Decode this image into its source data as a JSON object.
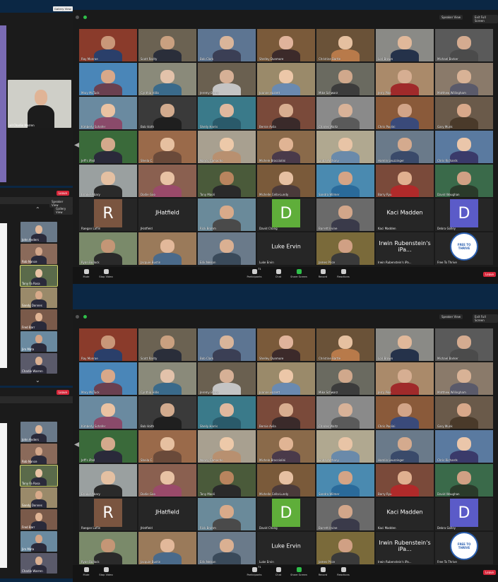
{
  "top_button": "Gallery View",
  "left": {
    "self_name": "all Charlie Warren",
    "leave_label": "Leave",
    "view_button": "Speaker View",
    "view_button2": "Gallery View",
    "list_a": [
      "John Anders",
      "Rob Nance",
      "Tony Fa Rosa",
      "Sandy Donnes",
      "Fred Barr",
      "Jim Mata",
      "Charlie Warren"
    ]
  },
  "window1": {
    "speaker_view": "Speaker View",
    "exit_full": "Exit Full Screen",
    "leave": "Leave",
    "participants_count": "71"
  },
  "window2": {
    "speaker_view": "Speaker View",
    "exit_full": "Exit Full Screen",
    "leave": "Leave",
    "participants_count": "71"
  },
  "controls": {
    "mute": "Mute",
    "stop_video": "Stop Video",
    "participants": "Participants",
    "chat": "Chat",
    "share_screen": "Share Screen",
    "record": "Record",
    "reactions": "Reactions"
  },
  "participants": [
    {
      "name": "Ray Monroe",
      "type": "video",
      "bg": "#8a3b2b",
      "skin": "#c99779",
      "shirt": "#2a3f6a"
    },
    {
      "name": "Scott Rarity",
      "type": "video",
      "bg": "#6b6252",
      "skin": "#c9a080",
      "shirt": "#2a2e3a"
    },
    {
      "name": "Bob Clark",
      "type": "video",
      "bg": "#5d7592",
      "skin": "#d9b59a",
      "shirt": "#3b3f55"
    },
    {
      "name": "Shelley Dunmore",
      "type": "video",
      "bg": "#7a5a3a",
      "skin": "#e0b39b",
      "shirt": "#3c2a2a"
    },
    {
      "name": "Christine Bartle",
      "type": "video",
      "bg": "#6a5238",
      "skin": "#e5c0a0",
      "shirt": "#b87a4a"
    },
    {
      "name": "Lori Brown",
      "type": "video",
      "bg": "#8a8a86",
      "skin": "#e0b89a",
      "shirt": "#25324a"
    },
    {
      "name": "Michael Barker",
      "type": "video",
      "bg": "#5a5a5a",
      "skin": "#d4ab90",
      "shirt": "#4b4b4b"
    },
    {
      "name": "Mary McTuck",
      "type": "video",
      "bg": "#4a86b8",
      "skin": "#d8a889",
      "shirt": "#6a4050"
    },
    {
      "name": "Cynthia Hillis",
      "type": "video",
      "bg": "#8a8a7a",
      "skin": "#e2c2aa",
      "shirt": "#3a6a8a"
    },
    {
      "name": "Jeremy Burns",
      "type": "video",
      "bg": "#6a6050",
      "skin": "#d6b096",
      "shirt": "#c4c4c4"
    },
    {
      "name": "Joanne Hazlett",
      "type": "video",
      "bg": "#9a8a6a",
      "skin": "#ecc7a8",
      "shirt": "#6a8ab0"
    },
    {
      "name": "Mike Schwarz",
      "type": "video",
      "bg": "#6a6a60",
      "skin": "#d0a88c",
      "shirt": "#3c3c3c"
    },
    {
      "name": "Jerry Pike",
      "type": "video",
      "bg": "#aa8a6a",
      "skin": "#d6ae92",
      "shirt": "#a02a2a"
    },
    {
      "name": "Matthew Willingham",
      "type": "video",
      "bg": "#8a7a6a",
      "skin": "#d8b296",
      "shirt": "#5a5a6a"
    },
    {
      "name": "Kimberly Schafer",
      "type": "video",
      "bg": "#6a8aa0",
      "skin": "#eac2a2",
      "shirt": "#8a4a6a"
    },
    {
      "name": "Bob Voith",
      "type": "video",
      "bg": "#3a3a3a",
      "skin": "#d2ab8e",
      "shirt": "#1f1f1f"
    },
    {
      "name": "Shelly Harris",
      "type": "video",
      "bg": "#3a7a8a",
      "skin": "#e0b89e",
      "shirt": "#2a5a6a"
    },
    {
      "name": "Bernie Avila",
      "type": "video",
      "bg": "#7a4a3a",
      "skin": "#d8ae90",
      "shirt": "#3a2a2a"
    },
    {
      "name": "Charles Waltz",
      "type": "video",
      "bg": "#8a8a8a",
      "skin": "#d8b298",
      "shirt": "#5a5a5a"
    },
    {
      "name": "Chris Paolini",
      "type": "video",
      "bg": "#8a5a3a",
      "skin": "#d2a488",
      "shirt": "#3a4a7a"
    },
    {
      "name": "Gary Munk",
      "type": "video",
      "bg": "#6a5a4a",
      "skin": "#d8a88a",
      "shirt": "#4a3a2a"
    },
    {
      "name": "Jeff's iPad",
      "type": "video",
      "bg": "#3a6a3a",
      "skin": "#d4a98c",
      "shirt": "#2a2a3a"
    },
    {
      "name": "Sheila C.",
      "type": "video",
      "bg": "#9a6a4a",
      "skin": "#e6c0a0",
      "shirt": "#6a4a3a"
    },
    {
      "name": "Nancy Camacho",
      "type": "video",
      "bg": "#a8a090",
      "skin": "#edc9a9",
      "shirt": "#b89070"
    },
    {
      "name": "Michele Bracciolini",
      "type": "video",
      "bg": "#8a6a4a",
      "skin": "#e0b494",
      "shirt": "#4a3a4a"
    },
    {
      "name": "Linda Anthony",
      "type": "video",
      "bg": "#b0a890",
      "skin": "#e8c4a6",
      "shirt": "#6a8aaa"
    },
    {
      "name": "Hamlin Leuzzinger",
      "type": "video",
      "bg": "#6a7a8a",
      "skin": "#d4aa8e",
      "shirt": "#3a4a6a"
    },
    {
      "name": "Chris Richards",
      "type": "video",
      "bg": "#5a7aa0",
      "skin": "#eac6aa",
      "shirt": "#3a3a6a"
    },
    {
      "name": "Brooke Abary",
      "type": "video",
      "bg": "#9aa0a0",
      "skin": "#e4c0a2",
      "shirt": "#2a2a2a"
    },
    {
      "name": "Dodie Goo",
      "type": "video",
      "bg": "#8a6050",
      "skin": "#e8c2a4",
      "shirt": "#9a4a6a"
    },
    {
      "name": "Tony Maoli",
      "type": "video",
      "bg": "#4a5a3a",
      "skin": "#b8845e",
      "shirt": "#2a2a2a"
    },
    {
      "name": "Michelle Cella-Lundy",
      "type": "video",
      "bg": "#7a5a3a",
      "skin": "#e6c0a2",
      "shirt": "#4a3a3a"
    },
    {
      "name": "Sandra Wilmer",
      "type": "video",
      "bg": "#4a8ab0",
      "skin": "#d4a486",
      "shirt": "#2a6a9a"
    },
    {
      "name": "Barry Ryu",
      "type": "video",
      "bg": "#7a4a3a",
      "skin": "#e0b090",
      "shirt": "#b02a2a"
    },
    {
      "name": "David Woughan",
      "type": "video",
      "bg": "#3a6a4a",
      "skin": "#d0a084",
      "shirt": "#2a3a2a"
    },
    {
      "name": "Raegan Laflin",
      "type": "letter",
      "letter": "R",
      "box": "#7a5540"
    },
    {
      "name": "JHatfield",
      "type": "text",
      "text": "JHatfield"
    },
    {
      "name": "Rick Brohm",
      "type": "video",
      "bg": "#6a8a9a",
      "skin": "#d8aa8a",
      "shirt": "#4a4a4a"
    },
    {
      "name": "David Chang",
      "type": "letter",
      "letter": "D",
      "box": "#5fae3a"
    },
    {
      "name": "Barrett Irvine",
      "type": "video",
      "bg": "#6a6a6a",
      "skin": "#d2a68a",
      "shirt": "#3a3a4a"
    },
    {
      "name": "Kaci Madden",
      "type": "text",
      "text": "Kaci Madden"
    },
    {
      "name": "Debra Golley",
      "type": "letter",
      "letter": "D",
      "box": "#5b5bc8"
    },
    {
      "name": "Ryan Bullock",
      "type": "video",
      "bg": "#7a8a6a",
      "skin": "#c49676",
      "shirt": "#2a2a2a"
    },
    {
      "name": "Jacquie Bustin",
      "type": "video",
      "bg": "#9a7a5a",
      "skin": "#e2b89a",
      "shirt": "#4a6a8a"
    },
    {
      "name": "Erik Nelson",
      "type": "video",
      "bg": "#6a7a8a",
      "skin": "#dab092",
      "shirt": "#3a4a5a"
    },
    {
      "name": "Luke Ervin",
      "type": "text",
      "text": "Luke Ervin"
    },
    {
      "name": "James Price",
      "type": "video",
      "bg": "#7a6a3a",
      "skin": "#d0a084",
      "shirt": "#3a3a3a"
    },
    {
      "name": "Irwin Rubenstein's iPa...",
      "type": "text",
      "text": "Irwin Rubenstein's iPa..."
    },
    {
      "name": "Free To Thrive",
      "type": "logo",
      "text": "FREE TO THRIVE"
    }
  ]
}
